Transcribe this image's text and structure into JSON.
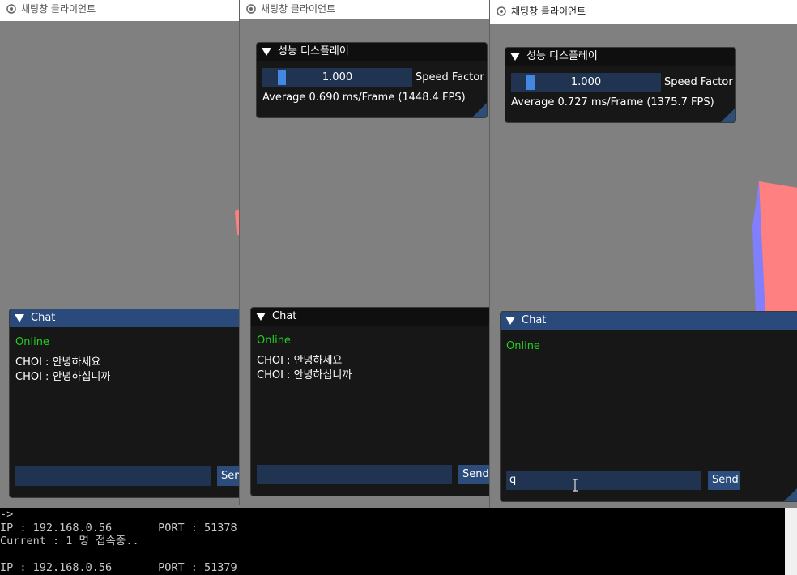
{
  "windows": [
    {
      "title": "채팅창 클라이언트",
      "chat": {
        "header": "Chat",
        "status": "Online",
        "messages": [
          "CHOI : 안녕하세요",
          "CHOI : 안녕하십니까"
        ],
        "input_value": "",
        "send_label": "Send"
      }
    },
    {
      "title": "채팅창 클라이언트",
      "perf": {
        "header": "성능 디스플레이",
        "slider_value": "1.000",
        "slider_label": "Speed Factor",
        "average": "Average 0.690 ms/Frame (1448.4 FPS)"
      },
      "chat": {
        "header": "Chat",
        "status": "Online",
        "messages": [
          "CHOI : 안녕하세요",
          "CHOI : 안녕하십니까"
        ],
        "input_value": "",
        "send_label": "Send"
      }
    },
    {
      "title": "채팅창 클라이언트",
      "perf": {
        "header": "성능 디스플레이",
        "slider_value": "1.000",
        "slider_label": "Speed Factor",
        "average": "Average 0.727 ms/Frame (1375.7 FPS)"
      },
      "chat": {
        "header": "Chat",
        "status": "Online",
        "messages": [],
        "input_value": "q",
        "send_label": "Send"
      }
    }
  ],
  "console": {
    "lines": [
      "->",
      "IP : 192.168.0.56       PORT : 51378",
      "Current : 1 명 접속중..",
      "",
      "IP : 192.168.0.56       PORT : 51379"
    ]
  },
  "colors": {
    "online": "#22d022",
    "chat_header": "#294a7a",
    "slider_fill": "#4287e0",
    "cube_red": "#ff8080",
    "cube_blue": "#8080ff"
  }
}
